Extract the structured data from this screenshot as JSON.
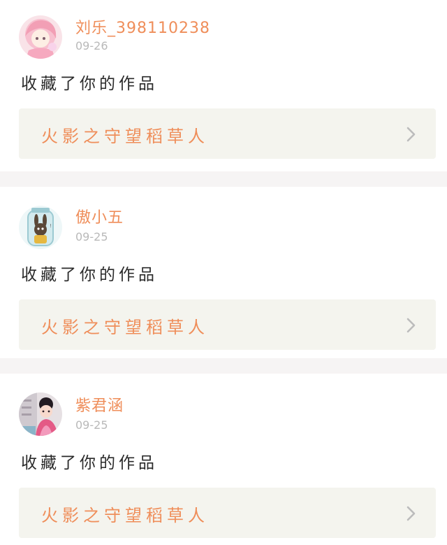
{
  "feed": {
    "items": [
      {
        "username": "刘乐_398110238",
        "date": "09-26",
        "action": "收藏了你的作品",
        "work_title": "火影之守望稻草人",
        "avatar": "pink-hair-anime-girl",
        "colors": {
          "bg": "#f7d7df",
          "accent": "#f2a9bd"
        }
      },
      {
        "username": "傲小五",
        "date": "09-25",
        "action": "收藏了你的作品",
        "work_title": "火影之守望稻草人",
        "avatar": "bunny-in-glass-jar",
        "colors": {
          "bg": "#d7ecef",
          "accent": "#5a4838"
        }
      },
      {
        "username": "紫君涵",
        "date": "09-25",
        "action": "收藏了你的作品",
        "work_title": "火影之守望稻草人",
        "avatar": "costumed-girl-portrait",
        "colors": {
          "bg": "#d9d2d6",
          "accent": "#e45a86"
        }
      }
    ]
  },
  "theme": {
    "name_color": "#ef8e5a",
    "work_bg": "#f4f4ee",
    "date_color": "#b9b9b9",
    "separator": "#f6f4f4"
  },
  "icons": {
    "chevron": "chevron-right-icon"
  }
}
